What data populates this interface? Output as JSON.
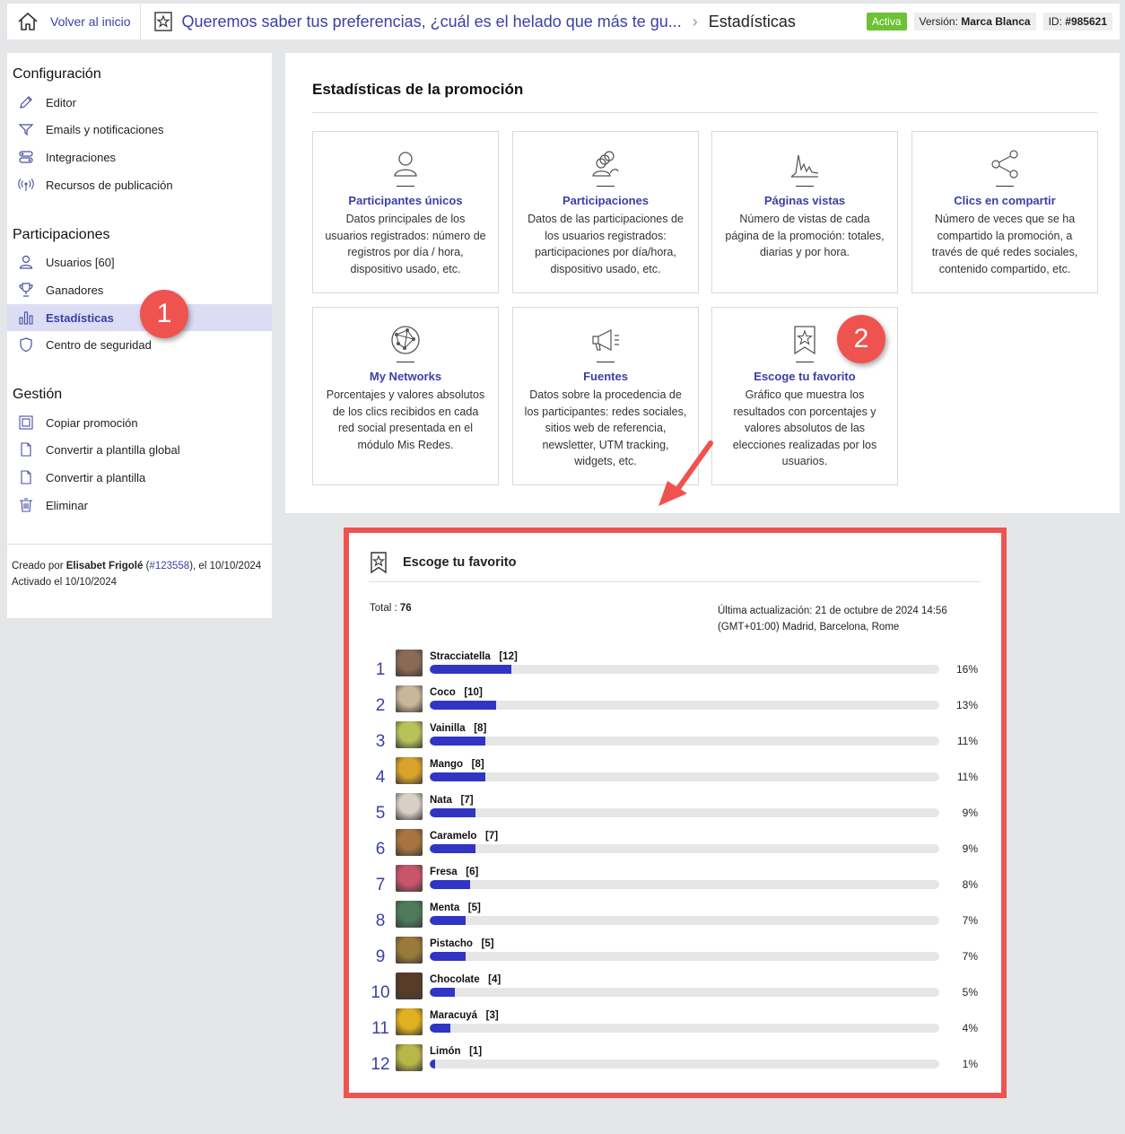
{
  "topbar": {
    "home_label": "Volver al inicio",
    "promo_title": "Queremos saber tus preferencias, ¿cuál es el helado que más te gu...",
    "crumb": "Estadísticas",
    "status": "Activa",
    "version_label": "Versión:",
    "version_value": "Marca Blanca",
    "id_label": "ID:",
    "id_value": "#985621"
  },
  "sidebar": {
    "config_title": "Configuración",
    "config_items": [
      "Editor",
      "Emails y notificaciones",
      "Integraciones",
      "Recursos de publicación"
    ],
    "part_title": "Participaciones",
    "part_items": [
      "Usuarios [60]",
      "Ganadores",
      "Estadísticas",
      "Centro de seguridad"
    ],
    "gestion_title": "Gestión",
    "gestion_items": [
      "Copiar promoción",
      "Convertir a plantilla global",
      "Convertir a plantilla",
      "Eliminar"
    ],
    "footer": {
      "created_prefix": "Creado por",
      "author": "Elisabet Frigolé",
      "author_id": "#123558",
      "created_date": "), el 10/10/2024",
      "activated": "Activado el 10/10/2024"
    }
  },
  "markers": {
    "one": "1",
    "two": "2"
  },
  "main": {
    "title": "Estadísticas de la promoción",
    "cards": [
      {
        "title": "Participantes únicos",
        "desc": "Datos principales de los usuarios registrados: número de registros por día / hora, dispositivo usado, etc.",
        "icon": "user-icon"
      },
      {
        "title": "Participaciones",
        "desc": "Datos de las participaciones de los usuarios registrados: participaciones por día/hora, dispositivo usado, etc.",
        "icon": "users-icon"
      },
      {
        "title": "Páginas vistas",
        "desc": "Número de vistas de cada página de la promoción: totales, diarias y por hora.",
        "icon": "pageviews-chart-icon"
      },
      {
        "title": "Clics en compartir",
        "desc": "Número de veces que se ha compartido la promoción, a través de qué redes sociales, contenido compartido, etc.",
        "icon": "share-icon"
      },
      {
        "title": "My Networks",
        "desc": "Porcentajes y valores absolutos de los clics recibidos en cada red social presentada en el módulo Mis Redes.",
        "icon": "network-globe-icon"
      },
      {
        "title": "Fuentes",
        "desc": "Datos sobre la procedencia de los participantes: redes sociales, sitios web de referencia, newsletter, UTM tracking, widgets, etc.",
        "icon": "megaphone-icon"
      },
      {
        "title": "Escoge tu favorito",
        "desc": "Gráfico que muestra los resultados con porcentajes y valores absolutos de las elecciones realizadas por los usuarios.",
        "icon": "star-bookmark-icon"
      }
    ]
  },
  "favorite": {
    "title": "Escoge tu favorito",
    "total_label": "Total :",
    "total_value": "76",
    "update": "Última actualización: 21 de octubre de 2024 14:56 (GMT+01:00) Madrid, Barcelona, Rome",
    "items": [
      {
        "rank": "1",
        "name": "Stracciatella",
        "votes": "[12]",
        "pct": "16%",
        "value": 16,
        "color": "#8a6a55"
      },
      {
        "rank": "2",
        "name": "Coco",
        "votes": "[10]",
        "pct": "13%",
        "value": 13,
        "color": "#c9b79a"
      },
      {
        "rank": "3",
        "name": "Vainilla",
        "votes": "[8]",
        "pct": "11%",
        "value": 11,
        "color": "#b8c25a"
      },
      {
        "rank": "4",
        "name": "Mango",
        "votes": "[8]",
        "pct": "11%",
        "value": 11,
        "color": "#d9a22a"
      },
      {
        "rank": "5",
        "name": "Nata",
        "votes": "[7]",
        "pct": "9%",
        "value": 9,
        "color": "#d8d0c4"
      },
      {
        "rank": "6",
        "name": "Caramelo",
        "votes": "[7]",
        "pct": "9%",
        "value": 9,
        "color": "#a8733f"
      },
      {
        "rank": "7",
        "name": "Fresa",
        "votes": "[6]",
        "pct": "8%",
        "value": 8,
        "color": "#c9556a"
      },
      {
        "rank": "8",
        "name": "Menta",
        "votes": "[5]",
        "pct": "7%",
        "value": 7,
        "color": "#4f7a5a"
      },
      {
        "rank": "9",
        "name": "Pistacho",
        "votes": "[5]",
        "pct": "7%",
        "value": 7,
        "color": "#9a7a3a"
      },
      {
        "rank": "10",
        "name": "Chocolate",
        "votes": "[4]",
        "pct": "5%",
        "value": 5,
        "color": "#5a3a28"
      },
      {
        "rank": "11",
        "name": "Maracuyá",
        "votes": "[3]",
        "pct": "4%",
        "value": 4,
        "color": "#e0b020"
      },
      {
        "rank": "12",
        "name": "Limón",
        "votes": "[1]",
        "pct": "1%",
        "value": 1,
        "color": "#b9b64a"
      }
    ],
    "colors": {
      "bar": "#3035c4",
      "track": "#e6e6e6",
      "accent": "#3b3fa6",
      "highlight": "#ef5350"
    }
  }
}
